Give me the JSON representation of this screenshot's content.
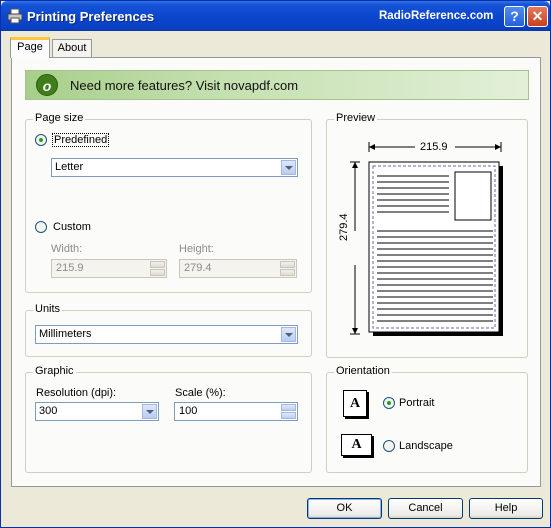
{
  "titlebar": {
    "title": "Printing Preferences",
    "site": "RadioReference.com",
    "help_icon": "?",
    "close_icon": "✕"
  },
  "tabs": [
    {
      "label": "Page",
      "active": true
    },
    {
      "label": "About",
      "active": false
    }
  ],
  "banner": {
    "text": "Need more features? Visit novapdf.com",
    "logo_letter": "o"
  },
  "page_size": {
    "group_label": "Page size",
    "predefined_label": "Predefined",
    "predefined_selected": true,
    "paper_value": "Letter",
    "custom_label": "Custom",
    "width_label": "Width:",
    "width_value": "215.9",
    "height_label": "Height:",
    "height_value": "279.4"
  },
  "units": {
    "group_label": "Units",
    "value": "Millimeters"
  },
  "graphic": {
    "group_label": "Graphic",
    "resolution_label": "Resolution (dpi):",
    "resolution_value": "300",
    "scale_label": "Scale (%):",
    "scale_value": "100"
  },
  "preview": {
    "group_label": "Preview",
    "width_dim": "215.9",
    "height_dim": "279.4"
  },
  "orientation": {
    "group_label": "Orientation",
    "portrait_label": "Portrait",
    "portrait_selected": true,
    "landscape_label": "Landscape",
    "icon_letter": "A"
  },
  "buttons": {
    "ok": "OK",
    "cancel": "Cancel",
    "help": "Help"
  }
}
